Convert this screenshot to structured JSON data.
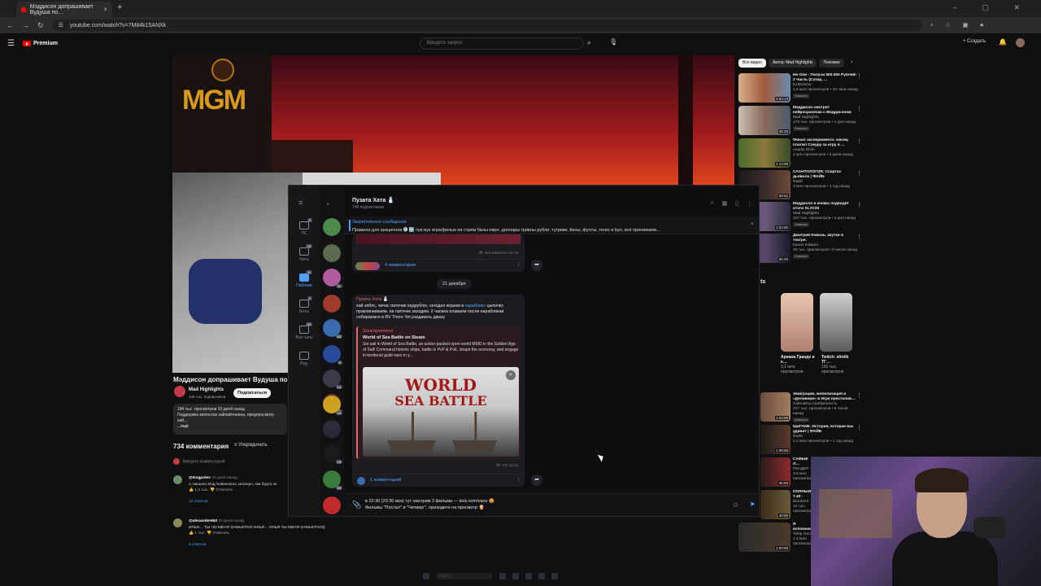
{
  "browser": {
    "tab_title": "Мэддисон допрашивает Вудуша по…",
    "tab_close": "×",
    "new_tab": "+",
    "url": "youtube.com/watch?v=7M84k15ANXk",
    "window_controls": "– ▢ ✕"
  },
  "youtube": {
    "logo_text": "Premium",
    "search_placeholder": "Введите запрос",
    "create_label": "+ Создать",
    "video_title": "Мэддисон допрашивает Вудуша по пов…",
    "channel_name": "Mad Highlights",
    "channel_subs": "436 тыс. подписчиков",
    "subscribe_label": "Подписаться",
    "description_stats": "184 тыс. просмотров  10 дней назад",
    "description_text": "Поддержка мелостки хайлайтнеина, предпросмотр хай…",
    "description_more": "...ещё",
    "comments_count": "734 комментария",
    "sort_label": "Упорядочить",
    "add_comment": "Введите комментарий",
    "comments": [
      {
        "author": "@Gogpoles",
        "time": "10 дней назад",
        "text": "А смешно Мэд Ховенского затюнул, хак будто эх",
        "likes": "1,4 тыс.",
        "reply": "Ответить",
        "replies": "10 ответов"
      },
      {
        "author": "@alexander653",
        "time": "10 дней назад",
        "text": "ИЛЬЯ… ТЫ ЧО МЕНЯ ЗАМЬЮТИЛ ИЛЬЯ… ИЛЬЯ ТЫ МЕНЯ ЗАМЬЮТИЛ((",
        "likes": "1 тыс.",
        "reply": "Ответить",
        "replies": "6 ответов"
      }
    ],
    "chips": [
      "Все видео",
      "Автор: Mad Highlights",
      "Похожие"
    ],
    "recommendations": [
      {
        "title": "Не Оли - Получи 500.000 Рублей! 2 Часть (Сатир, …",
        "channel": "ExileShow",
        "meta": "1,6 млн просмотров • 23 часа назад",
        "badge": "Новинка",
        "duration": "2:03:13"
      },
      {
        "title": "Мэддисон смотрит нейросрачечко с Мэддисоном",
        "channel": "Mad Highlights",
        "meta": "179 тыс. просмотров • 4 дня назад",
        "badge": "Новинка",
        "duration": "48:28"
      },
      {
        "title": "Финал эксперимента: месяц платил Сокуру за игру в …",
        "channel": "Asadis Kmin",
        "meta": "1 млн просмотров • 5 дней назад",
        "badge": "",
        "duration": "1:13:09"
      },
      {
        "title": "СААНТОЛОГИЯ. Спартак дьявола | ФАЙБ",
        "channel": "Файб",
        "meta": "3 млн просмотров • 1 год назад",
        "badge": "",
        "duration": "58:52"
      },
      {
        "title": "Мэддисон и конфа подводят итоги SLAY25",
        "channel": "Mad Highlights",
        "meta": "127 тыс. просмотров • 3 дня назад",
        "badge": "Новинка",
        "duration": "1:02:55"
      },
      {
        "title": "Дмитрий Коваль. Шутки в театре.",
        "channel": "Канал Коваля",
        "meta": "30 тыс. просмотров • 5 часов назад",
        "badge": "Новинка",
        "duration": "28:25"
      }
    ],
    "shorts_heading": "ts",
    "shorts": [
      {
        "title": "Ариана Гранде и е…",
        "views": "3,1 млн просмотров"
      },
      {
        "title": "Twitch: stintik ТГ…",
        "views": "193 тыс. просмотров"
      }
    ],
    "recommendations2": [
      {
        "title": "Эмиграция, мобилизация и «Деливери» в Игре престолов…",
        "channel": "Хайлайты Скабрезность",
        "meta": "227 тыс. просмотров • 6 часов назад",
        "badge": "Новинка",
        "duration": "1:23:09"
      },
      {
        "title": "ЦЫГАНЕ. История, которая вас удивит | ФАЙБ",
        "channel": "Файб",
        "meta": "2,1 млн просмотров • 1 год назад",
        "badge": "",
        "duration": "1:09:55"
      },
      {
        "title": "САМЫЕ Л… СТРИМЕР…",
        "channel": "РЕНДЕР",
        "meta": "3,6 млн просмотров",
        "badge": "",
        "duration": "35:00"
      },
      {
        "title": "ПОЛНЫЙ 7.40 - ВОЗ…",
        "channel": "BoroDeX",
        "meta": "12 тыс. просмотров",
        "badge": "",
        "duration": "40:00"
      },
      {
        "title": "Я вспомнил Мафию. Кл…",
        "channel": "Telep Gen",
        "meta": "1,4 млн просмотров",
        "badge": "",
        "duration": "1:00:00"
      }
    ]
  },
  "telegram": {
    "rail": [
      {
        "label": "ЛС",
        "count": "2"
      },
      {
        "label": "Чаты",
        "count": "15"
      },
      {
        "label": "Паблики",
        "count": "11"
      },
      {
        "label": "Боты",
        "count": "1"
      },
      {
        "label": "Все чаты",
        "count": "43"
      },
      {
        "label": "Ред.",
        "count": ""
      }
    ],
    "chat_badges": [
      "",
      "",
      "11",
      "",
      "83",
      "6",
      "14",
      "8",
      "29",
      "",
      "15",
      "59",
      ""
    ],
    "channel_name": "Пузата Хата 🧂",
    "subscribers": "748 подписчиков",
    "pinned_label": "Закреплённое сообщение",
    "pinned_text": "Правила для аукционов 🅒 🆕 пук-вук игра/фильм на стрим балы евро, доллары гривны рубли, тугрики, йены, фунты, тенге и byn, всё принимаем…",
    "post1_meta": "👁 182  изменено 19:38",
    "post1_comments": "4 комментария",
    "date_separator": "21 декабря",
    "post2_author": "Пузата Хата 🧂",
    "post2_text_a": "хай зяблс, чичас паточик падрублю, сегодня играем в",
    "post2_link": "карабликн",
    "post2_text_b": "цыпочку праклинкиваем. на паточек заходим. 2 часика плаваем после карабликав собираемся в RV There Yet раздавать джазу",
    "preview_site": "Steampowered",
    "preview_title": "World of Sea Battle on Steam",
    "preview_desc": "Set sail in World of Sea Battle, an action-packed open-world MMO in the Golden Age of Sail! Command historic ships, battle in PvP & PvE, shape the economy, and engage in territorial guild wars in y…",
    "preview_logo_line1": "WORLD",
    "preview_logo_line2": "SEA BATTLE",
    "post2_meta": "👁 152  15:23",
    "post2_comments": "1 комментарий",
    "composer_line1": "в 22:30 (23:30 мск) тут смотрим 2 фильма — kick.com/vano 🤩",
    "composer_line2": "Фильмы \"Постал\" и \"Четверг\", приходите на просмотр 🍿"
  },
  "taskbar": {
    "search": "Поиск"
  }
}
